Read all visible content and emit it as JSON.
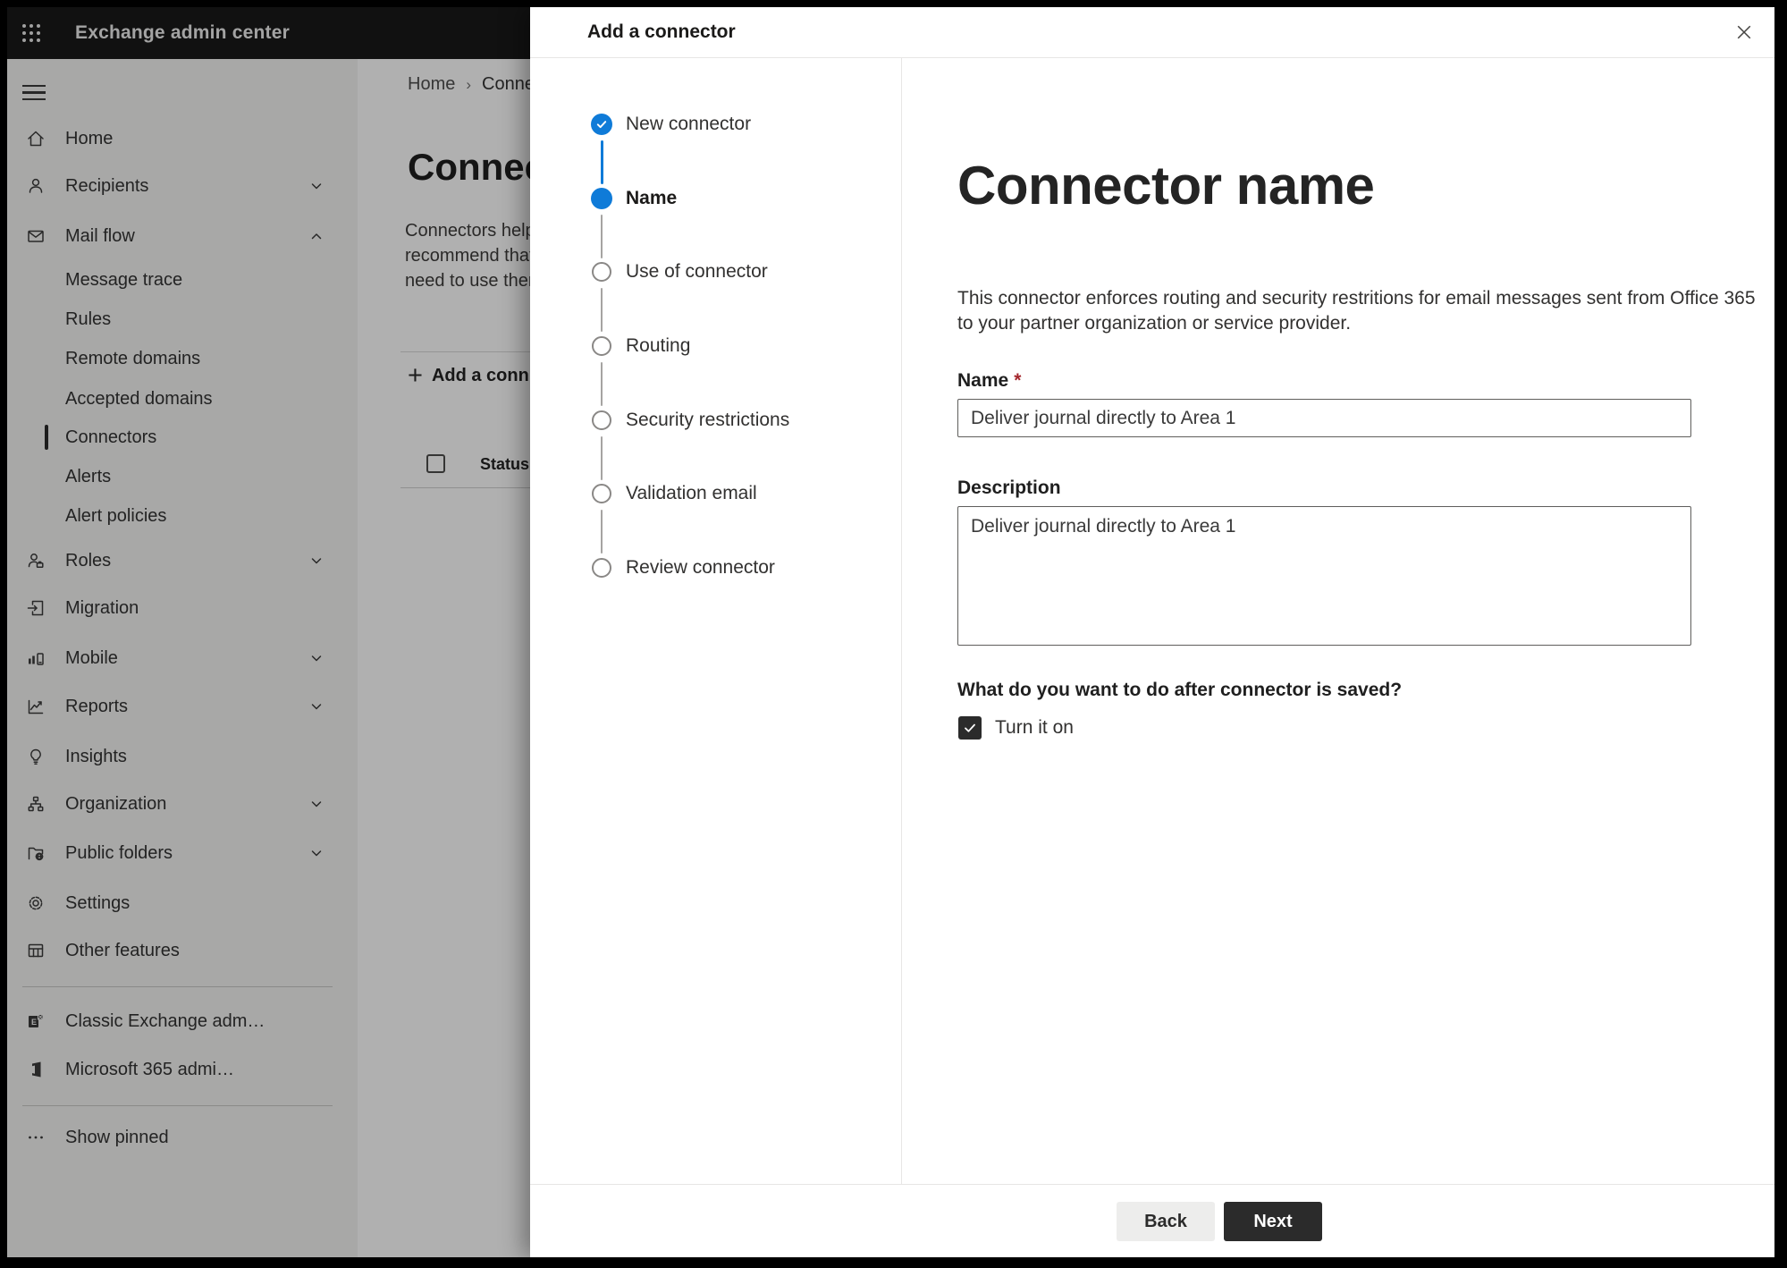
{
  "colors": {
    "accent_blue": "#0f7bd8",
    "suite_header_bg": "#1a1a19",
    "primary_button_bg": "#2b2b2b",
    "required_asterisk": "#a4262c",
    "sidebar_bg": "#f3f3f2"
  },
  "suite_header": {
    "title": "Exchange admin center"
  },
  "sidebar": {
    "items": [
      {
        "label": "Home",
        "icon": "home"
      },
      {
        "label": "Recipients",
        "icon": "person",
        "chevron": "down"
      },
      {
        "label": "Mail flow",
        "icon": "mail",
        "chevron": "up"
      },
      {
        "label": "Message trace",
        "type": "sub"
      },
      {
        "label": "Rules",
        "type": "sub"
      },
      {
        "label": "Remote domains",
        "type": "sub"
      },
      {
        "label": "Accepted domains",
        "type": "sub"
      },
      {
        "label": "Connectors",
        "type": "sub",
        "selected": true
      },
      {
        "label": "Alerts",
        "type": "sub"
      },
      {
        "label": "Alert policies",
        "type": "sub"
      },
      {
        "label": "Roles",
        "icon": "roles",
        "chevron": "down"
      },
      {
        "label": "Migration",
        "icon": "migration"
      },
      {
        "label": "Mobile",
        "icon": "mobile",
        "chevron": "down"
      },
      {
        "label": "Reports",
        "icon": "reports",
        "chevron": "down"
      },
      {
        "label": "Insights",
        "icon": "insights"
      },
      {
        "label": "Organization",
        "icon": "organization",
        "chevron": "down"
      },
      {
        "label": "Public folders",
        "icon": "public-folders",
        "chevron": "down"
      },
      {
        "label": "Settings",
        "icon": "settings"
      },
      {
        "label": "Other features",
        "icon": "other-features"
      },
      {
        "label": "Classic Exchange adm…",
        "icon": "exchange-logo"
      },
      {
        "label": "Microsoft 365 admi…",
        "icon": "microsoft365-logo"
      },
      {
        "label": "Show pinned",
        "icon": "ellipsis"
      }
    ]
  },
  "page": {
    "breadcrumb": {
      "home": "Home",
      "current": "Conne"
    },
    "title": "Connec",
    "description": "Connectors help\nrecommend that\nneed to use ther",
    "add_button": "Add a conn",
    "add_plus": "+",
    "table": {
      "status_header": "Status"
    }
  },
  "dialog": {
    "title": "Add a connector",
    "steps": [
      {
        "label": "New connector",
        "state": "complete"
      },
      {
        "label": "Name",
        "state": "current"
      },
      {
        "label": "Use of connector",
        "state": "upcoming"
      },
      {
        "label": "Routing",
        "state": "upcoming"
      },
      {
        "label": "Security restrictions",
        "state": "upcoming"
      },
      {
        "label": "Validation email",
        "state": "upcoming"
      },
      {
        "label": "Review connector",
        "state": "upcoming"
      }
    ],
    "content": {
      "heading": "Connector name",
      "description": "This connector enforces routing and security restritions for email messages sent from Office 365\nto your partner organization or service provider.",
      "name_label": "Name",
      "required_mark": "*",
      "name_value": "Deliver journal directly to Area 1",
      "description_label": "Description",
      "description_value": "Deliver journal directly to Area 1",
      "question": "What do you want to do after connector is saved?",
      "checkbox_label": "Turn it on",
      "checkbox_checked": true
    },
    "footer": {
      "back": "Back",
      "next": "Next"
    }
  }
}
